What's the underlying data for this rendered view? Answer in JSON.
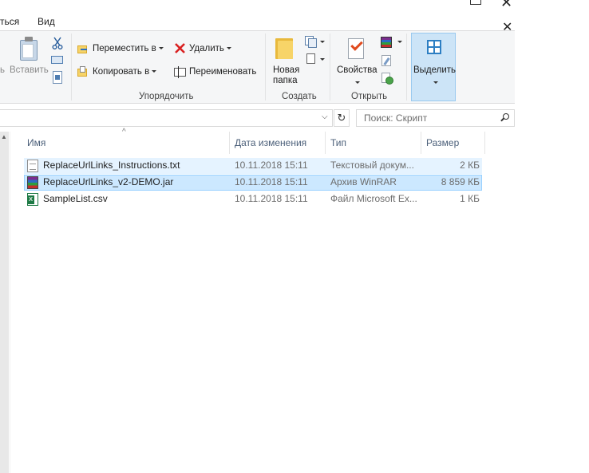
{
  "window": {
    "close_glyph": "✕",
    "restore_glyph": ""
  },
  "tabs": {
    "share_partial": "ться",
    "view": "Вид"
  },
  "clipboard": {
    "paste_partial": "ь",
    "paste_label": "Вставить"
  },
  "organize": {
    "move_to": "Переместить в",
    "copy_to": "Копировать в",
    "delete": "Удалить",
    "rename": "Переименовать",
    "group_label": "Упорядочить"
  },
  "create": {
    "new_folder_line1": "Новая",
    "new_folder_line2": "папка",
    "group_label": "Создать"
  },
  "open": {
    "properties": "Свойства",
    "group_label": "Открыть"
  },
  "select": {
    "label": "Выделить"
  },
  "address": {
    "refresh_glyph": "↻",
    "dropdown_glyph": "⌵"
  },
  "search": {
    "placeholder": "Поиск: Скрипт"
  },
  "columns": {
    "name": "Имя",
    "date": "Дата изменения",
    "type": "Тип",
    "size": "Размер"
  },
  "files": [
    {
      "name": "ReplaceUrlLinks_Instructions.txt",
      "date": "10.11.2018 15:11",
      "type": "Текстовый докум...",
      "size": "2 КБ",
      "icon": "text-file-icon"
    },
    {
      "name": "ReplaceUrlLinks_v2-DEMO.jar",
      "date": "10.11.2018 15:11",
      "type": "Архив WinRAR",
      "size": "8 859 КБ",
      "icon": "winrar-archive-icon"
    },
    {
      "name": "SampleList.csv",
      "date": "10.11.2018 15:11",
      "type": "Файл Microsoft Ex...",
      "size": "1 КБ",
      "icon": "excel-file-icon"
    }
  ]
}
